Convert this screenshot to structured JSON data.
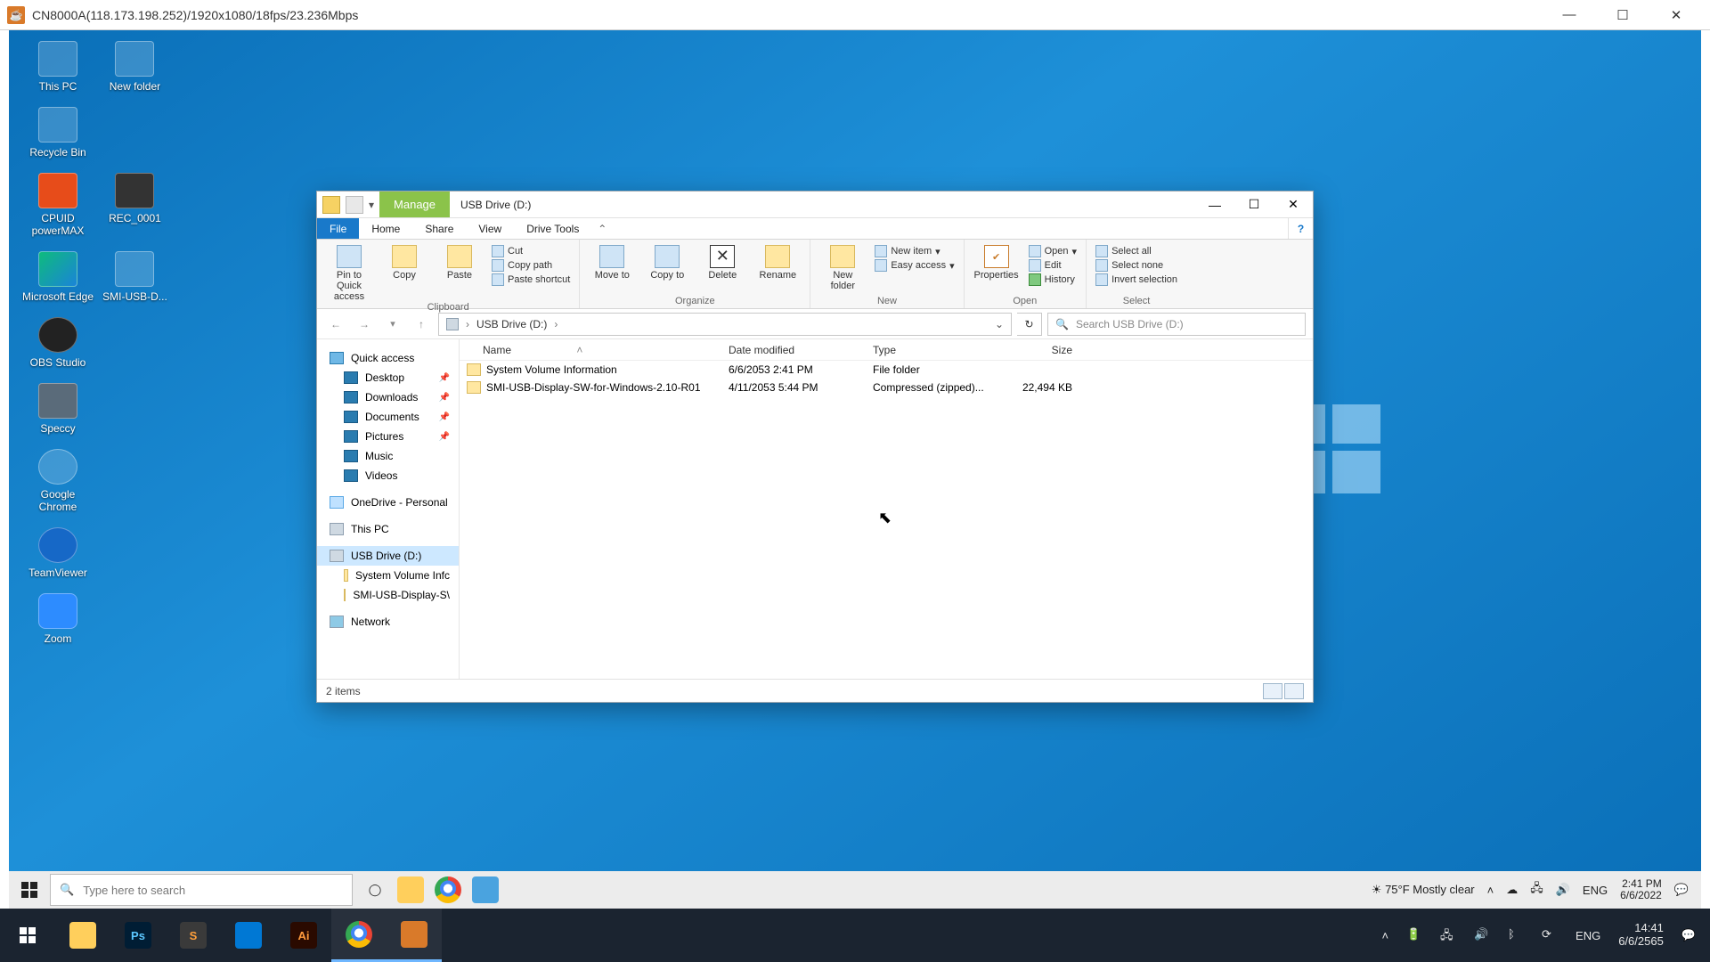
{
  "kvm_title": "CN8000A(118.173.198.252)/1920x1080/18fps/23.236Mbps",
  "desktop_icons": [
    "This PC",
    "New folder",
    "Recycle Bin",
    "CPUID powerMAX",
    "REC_0001",
    "Microsoft Edge",
    "SMI-USB-D...",
    "OBS Studio",
    "Speccy",
    "Google Chrome",
    "TeamViewer",
    "Zoom"
  ],
  "explorer": {
    "manage_tab": "Manage",
    "title": "USB Drive (D:)",
    "tabs": {
      "file": "File",
      "home": "Home",
      "share": "Share",
      "view": "View",
      "drive_tools": "Drive Tools"
    },
    "ribbon": {
      "pin": "Pin to Quick access",
      "copy": "Copy",
      "paste": "Paste",
      "cut": "Cut",
      "copy_path": "Copy path",
      "paste_shortcut": "Paste shortcut",
      "clipboard": "Clipboard",
      "move_to": "Move to",
      "copy_to": "Copy to",
      "delete": "Delete",
      "rename": "Rename",
      "organize": "Organize",
      "new_folder": "New folder",
      "new_item": "New item",
      "easy_access": "Easy access",
      "new": "New",
      "properties": "Properties",
      "open": "Open",
      "edit": "Edit",
      "history": "History",
      "open_grp": "Open",
      "select_all": "Select all",
      "select_none": "Select none",
      "invert": "Invert selection",
      "select": "Select"
    },
    "address": "USB Drive (D:)",
    "search_ph": "Search USB Drive (D:)",
    "nav": {
      "quick": "Quick access",
      "desktop": "Desktop",
      "downloads": "Downloads",
      "documents": "Documents",
      "pictures": "Pictures",
      "music": "Music",
      "videos": "Videos",
      "onedrive": "OneDrive - Personal",
      "thispc": "This PC",
      "usb": "USB Drive (D:)",
      "usb_c1": "System Volume Infc",
      "usb_c2": "SMI-USB-Display-S\\",
      "network": "Network"
    },
    "cols": {
      "name": "Name",
      "date": "Date modified",
      "type": "Type",
      "size": "Size"
    },
    "rows": [
      {
        "name": "System Volume Information",
        "date": "6/6/2053 2:41 PM",
        "type": "File folder",
        "size": ""
      },
      {
        "name": "SMI-USB-Display-SW-for-Windows-2.10-R01",
        "date": "4/11/2053 5:44 PM",
        "type": "Compressed (zipped)...",
        "size": "22,494 KB"
      }
    ],
    "status": "2 items"
  },
  "remote_taskbar": {
    "search_ph": "Type here to search",
    "weather": "75°F  Mostly clear",
    "lang": "ENG",
    "time": "2:41 PM",
    "date": "6/6/2022"
  },
  "host_taskbar": {
    "lang": "ENG",
    "time": "14:41",
    "date": "6/6/2565"
  }
}
